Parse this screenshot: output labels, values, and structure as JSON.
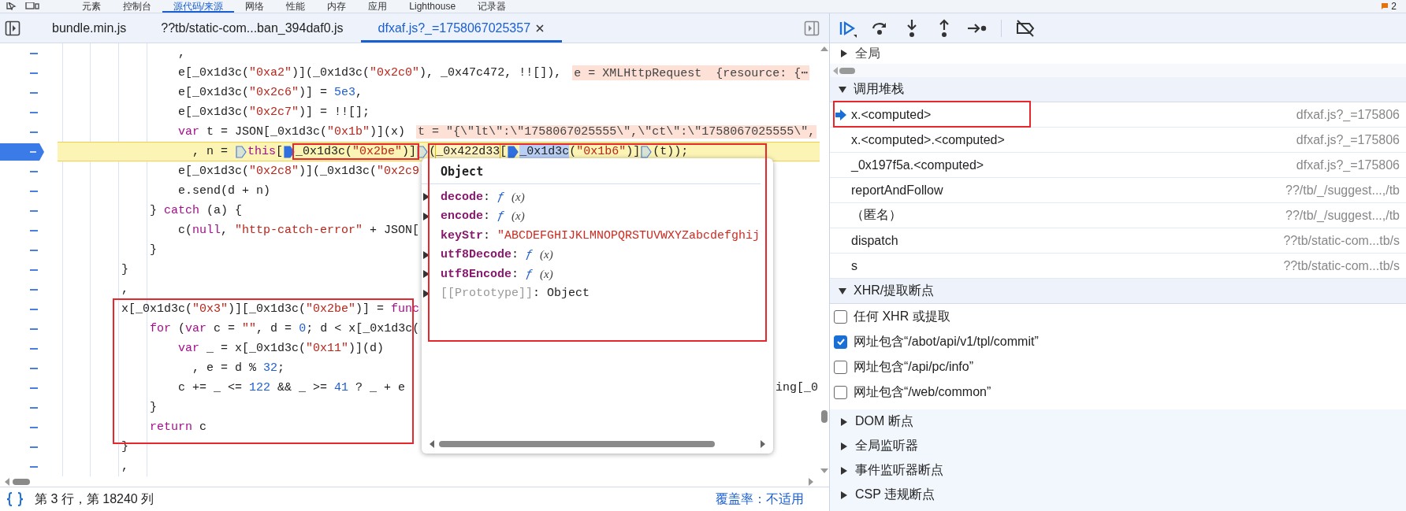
{
  "devtools_tabs": [
    {
      "label": "元素",
      "selected": false
    },
    {
      "label": "控制台",
      "selected": false
    },
    {
      "label": "源代码/来源",
      "selected": true
    },
    {
      "label": "网络",
      "selected": false
    },
    {
      "label": "性能",
      "selected": false
    },
    {
      "label": "内存",
      "selected": false
    },
    {
      "label": "应用",
      "selected": false
    },
    {
      "label": "Lighthouse",
      "selected": false
    },
    {
      "label": "记录器",
      "selected": false
    }
  ],
  "issues_count": "2",
  "file_tabs": [
    {
      "label": "bundle.min.js",
      "selected": false
    },
    {
      "label": "??tb/static-com...ban_394daf0.js",
      "selected": false
    },
    {
      "label": "dfxaf.js?_=1758067025357",
      "selected": true
    }
  ],
  "code": {
    "lines": [
      {
        "text": "                ,",
        "paused": false
      },
      {
        "text": "                e[_0x1d3c(\"0xa2\")](_0x1d3c(\"0x2c0\"), _0x47c472, !![]),",
        "paused": false,
        "inline_value": "e = XMLHttpRequest  {resource: {⋯"
      },
      {
        "text": "                e[_0x1d3c(\"0x2c6\")] = 5e3,",
        "paused": false
      },
      {
        "text": "                e[_0x1d3c(\"0x2c7\")] = !![];",
        "paused": false
      },
      {
        "text": "                var t = JSON[_0x1d3c(\"0x1b\")](x)",
        "paused": false,
        "inline_value": "t = \"{\\\"lt\\\":\\\"1758067025555\\\",\\\"ct\\\":\\\"1758067025555\\\","
      },
      {
        "paused": true,
        "parts": [
          {
            "kind": "text",
            "text": "                  , n = ",
            "hovered": false,
            "selected": false
          },
          {
            "kind": "marker",
            "active": false
          },
          {
            "kind": "text",
            "text": "this[",
            "hovered": false,
            "selected": false
          },
          {
            "kind": "marker",
            "active": true
          },
          {
            "kind": "text",
            "text": "_0x1d3c(\"0x2be\")]",
            "hovered": false,
            "selected": false,
            "boxed": true
          },
          {
            "kind": "marker",
            "active": false
          },
          {
            "kind": "text",
            "text": "(",
            "hovered": false,
            "selected": false
          },
          {
            "kind": "text",
            "text": "_0x422d33",
            "hovered": true,
            "selected": false
          },
          {
            "kind": "text",
            "text": "[",
            "hovered": false,
            "selected": false
          },
          {
            "kind": "marker",
            "active": true
          },
          {
            "kind": "text",
            "text": "_0x1d3c",
            "hovered": false,
            "selected": true
          },
          {
            "kind": "text",
            "text": "(\"0x1b6\")]",
            "hovered": false,
            "selected": false
          },
          {
            "kind": "marker",
            "active": false
          },
          {
            "kind": "text",
            "text": "(t));",
            "hovered": false,
            "selected": false
          }
        ]
      },
      {
        "text": "                e[_0x1d3c(\"0x2c8\")](_0x1d3c(\"0x2c9",
        "paused": false
      },
      {
        "text": "                e.send(d + n)",
        "paused": false
      },
      {
        "text": "            } catch (a) {",
        "paused": false
      },
      {
        "text": "                c(null, \"http-catch-error\" + JSON[",
        "paused": false
      },
      {
        "text": "            }",
        "paused": false
      },
      {
        "text": "        }",
        "paused": false
      },
      {
        "text": "        ,",
        "paused": false
      },
      {
        "text": "        x[_0x1d3c(\"0x3\")][_0x1d3c(\"0x2be\")] = func",
        "paused": false
      },
      {
        "text": "            for (var c = \"\", d = 0; d < x[_0x1d3c(",
        "paused": false
      },
      {
        "text": "                var _ = x[_0x1d3c(\"0x11\")](d)",
        "paused": false
      },
      {
        "text": "                  , e = d % 32;",
        "paused": false
      },
      {
        "text": "                c += _ <= 122 && _ >= 41 ? _ + e",
        "paused": false,
        "tail": "ing[_0"
      },
      {
        "text": "            }",
        "paused": false
      },
      {
        "text": "            return c",
        "paused": false
      },
      {
        "text": "        }",
        "paused": false
      },
      {
        "text": "        ,",
        "paused": false
      }
    ]
  },
  "popup": {
    "title": "Object",
    "properties": [
      {
        "key": "decode",
        "separator": ":",
        "kind": "function",
        "prefix": "ƒ",
        "value": "(x)",
        "expandable": true
      },
      {
        "key": "encode",
        "separator": ":",
        "kind": "function",
        "prefix": "ƒ",
        "value": "(x)",
        "expandable": true
      },
      {
        "key": "keyStr",
        "separator": ":",
        "kind": "string",
        "value": "\"ABCDEFGHIJKLMNOPQRSTUVWXYZabcdefghij",
        "expandable": false
      },
      {
        "key": "utf8Decode",
        "separator": ":",
        "kind": "function",
        "prefix": "ƒ",
        "value": "(x)",
        "expandable": true
      },
      {
        "key": "utf8Encode",
        "separator": ":",
        "kind": "function",
        "prefix": "ƒ",
        "value": "(x)",
        "expandable": true
      },
      {
        "key": "[[Prototype]]",
        "separator": ":",
        "kind": "internal",
        "value": "Object",
        "expandable": true
      }
    ]
  },
  "status_bar": {
    "position": "第 3 行，第 18240 列",
    "coverage": "覆盖率：不适用"
  },
  "scope": {
    "label": "全局",
    "expanded": false
  },
  "call_stack": {
    "title": "调用堆栈",
    "expanded": true,
    "frames": [
      {
        "name": "x.<computed>",
        "location": "dfxaf.js?_=175806",
        "selected": true
      },
      {
        "name": "x.<computed>.<computed>",
        "location": "dfxaf.js?_=175806",
        "selected": false
      },
      {
        "name": "_0x197f5a.<computed>",
        "location": "dfxaf.js?_=175806",
        "selected": false
      },
      {
        "name": "reportAndFollow",
        "location": "??/tb/_/suggest...,/tb",
        "selected": false
      },
      {
        "name": "（匿名）",
        "location": "??/tb/_/suggest...,/tb",
        "selected": false
      },
      {
        "name": "dispatch",
        "location": "??tb/static-com...tb/s",
        "selected": false
      },
      {
        "name": "s",
        "location": "??tb/static-com...tb/s",
        "selected": false
      }
    ]
  },
  "xhr_breakpoints": {
    "title": "XHR/提取断点",
    "expanded": true,
    "items": [
      {
        "label": "任何 XHR 或提取",
        "checked": false
      },
      {
        "label": "网址包含“/abot/api/v1/tpl/commit”",
        "checked": true
      },
      {
        "label": "网址包含“/api/pc/info”",
        "checked": false
      },
      {
        "label": "网址包含“/web/common”",
        "checked": false
      }
    ]
  },
  "sections": [
    {
      "title": "DOM 断点",
      "expanded": false
    },
    {
      "title": "全局监听器",
      "expanded": false
    },
    {
      "title": "事件监听器断点",
      "expanded": false
    },
    {
      "title": "CSP 违规断点",
      "expanded": false
    }
  ]
}
